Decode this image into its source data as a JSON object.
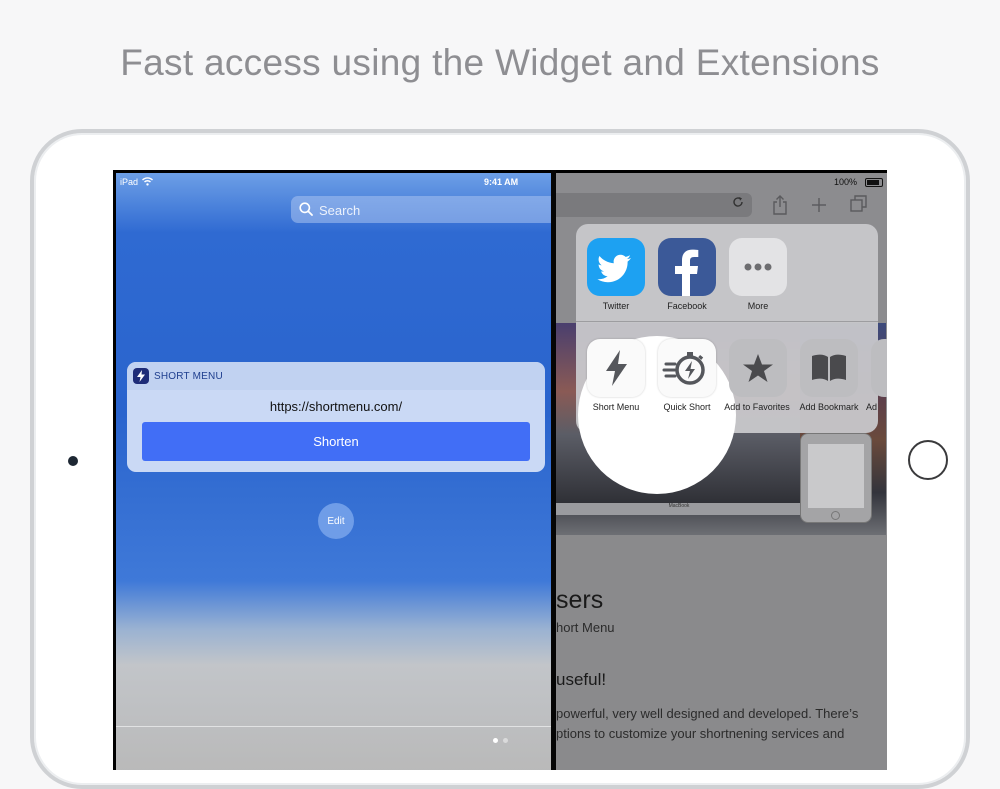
{
  "headline": "Fast access using the Widget and Extensions",
  "left_pane": {
    "status": {
      "device": "iPad",
      "time": "9:41 AM"
    },
    "search_placeholder": "Search",
    "widget": {
      "app_name": "SHORT MENU",
      "url": "https://shortmenu.com/",
      "button": "Shorten"
    },
    "edit_button": "Edit"
  },
  "right_pane": {
    "status": {
      "battery": "100%"
    },
    "share_row": [
      {
        "label": "Twitter",
        "icon": "twitter-icon",
        "color": "#1da1f2"
      },
      {
        "label": "Facebook",
        "icon": "facebook-icon",
        "color": "#3b5998"
      },
      {
        "label": "More",
        "icon": "more-icon",
        "color": "#e3e3e5"
      }
    ],
    "action_row": [
      {
        "label": "Short Menu",
        "icon": "lightning-icon"
      },
      {
        "label": "Quick Short",
        "icon": "stopwatch-lightning-icon"
      },
      {
        "label": "Add to Favorites",
        "icon": "star-icon"
      },
      {
        "label": "Add Bookmark",
        "icon": "book-icon"
      },
      {
        "label": "Ad",
        "icon": "partial-icon"
      }
    ],
    "laptop_caption": "MacBook",
    "page_text": {
      "heading": "sers",
      "subheading": "hort Menu",
      "section_title": "useful!",
      "line1": "powerful, very well designed and developed. There’s",
      "line2": "ptions to customize your shortnening services and"
    }
  },
  "colors": {
    "accent": "#416ef6",
    "twitter": "#1da1f2",
    "facebook": "#3b5998"
  }
}
